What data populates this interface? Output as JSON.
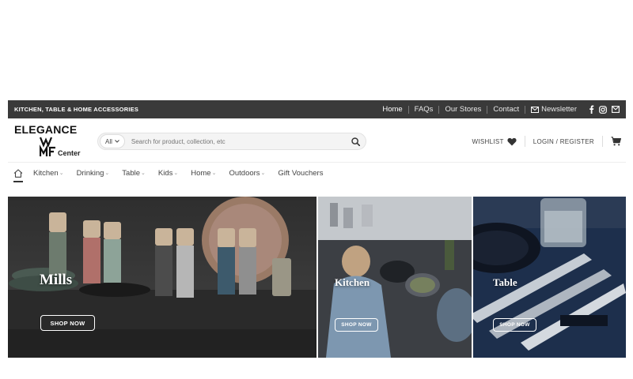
{
  "topbar": {
    "tagline": "KITCHEN, TABLE & HOME ACCESSORIES",
    "links": [
      "Home",
      "FAQs",
      "Our Stores",
      "Contact"
    ],
    "newsletter": "Newsletter",
    "social_icons": [
      "facebook-icon",
      "instagram-icon",
      "email-icon"
    ]
  },
  "header": {
    "logo_brand": "ELEGANCE",
    "logo_sub": "Center",
    "logo_mark": "WMF",
    "search_category": "All",
    "search_placeholder": "Search for product, collection, etc",
    "wishlist": "WISHLIST",
    "login": "LOGIN / REGISTER"
  },
  "catnav": {
    "items": [
      "Kitchen",
      "Drinking",
      "Table",
      "Kids",
      "Home",
      "Outdoors",
      "Gift Vouchers"
    ]
  },
  "hero": {
    "tiles": [
      {
        "label": "Mills",
        "button": "SHOP NOW"
      },
      {
        "label": "Kitchen",
        "button": "SHOP NOW"
      },
      {
        "label": "Table",
        "button": "SHOP NOW"
      }
    ]
  },
  "colors": {
    "topbar_bg": "#3a3a3a",
    "text": "#333333"
  }
}
